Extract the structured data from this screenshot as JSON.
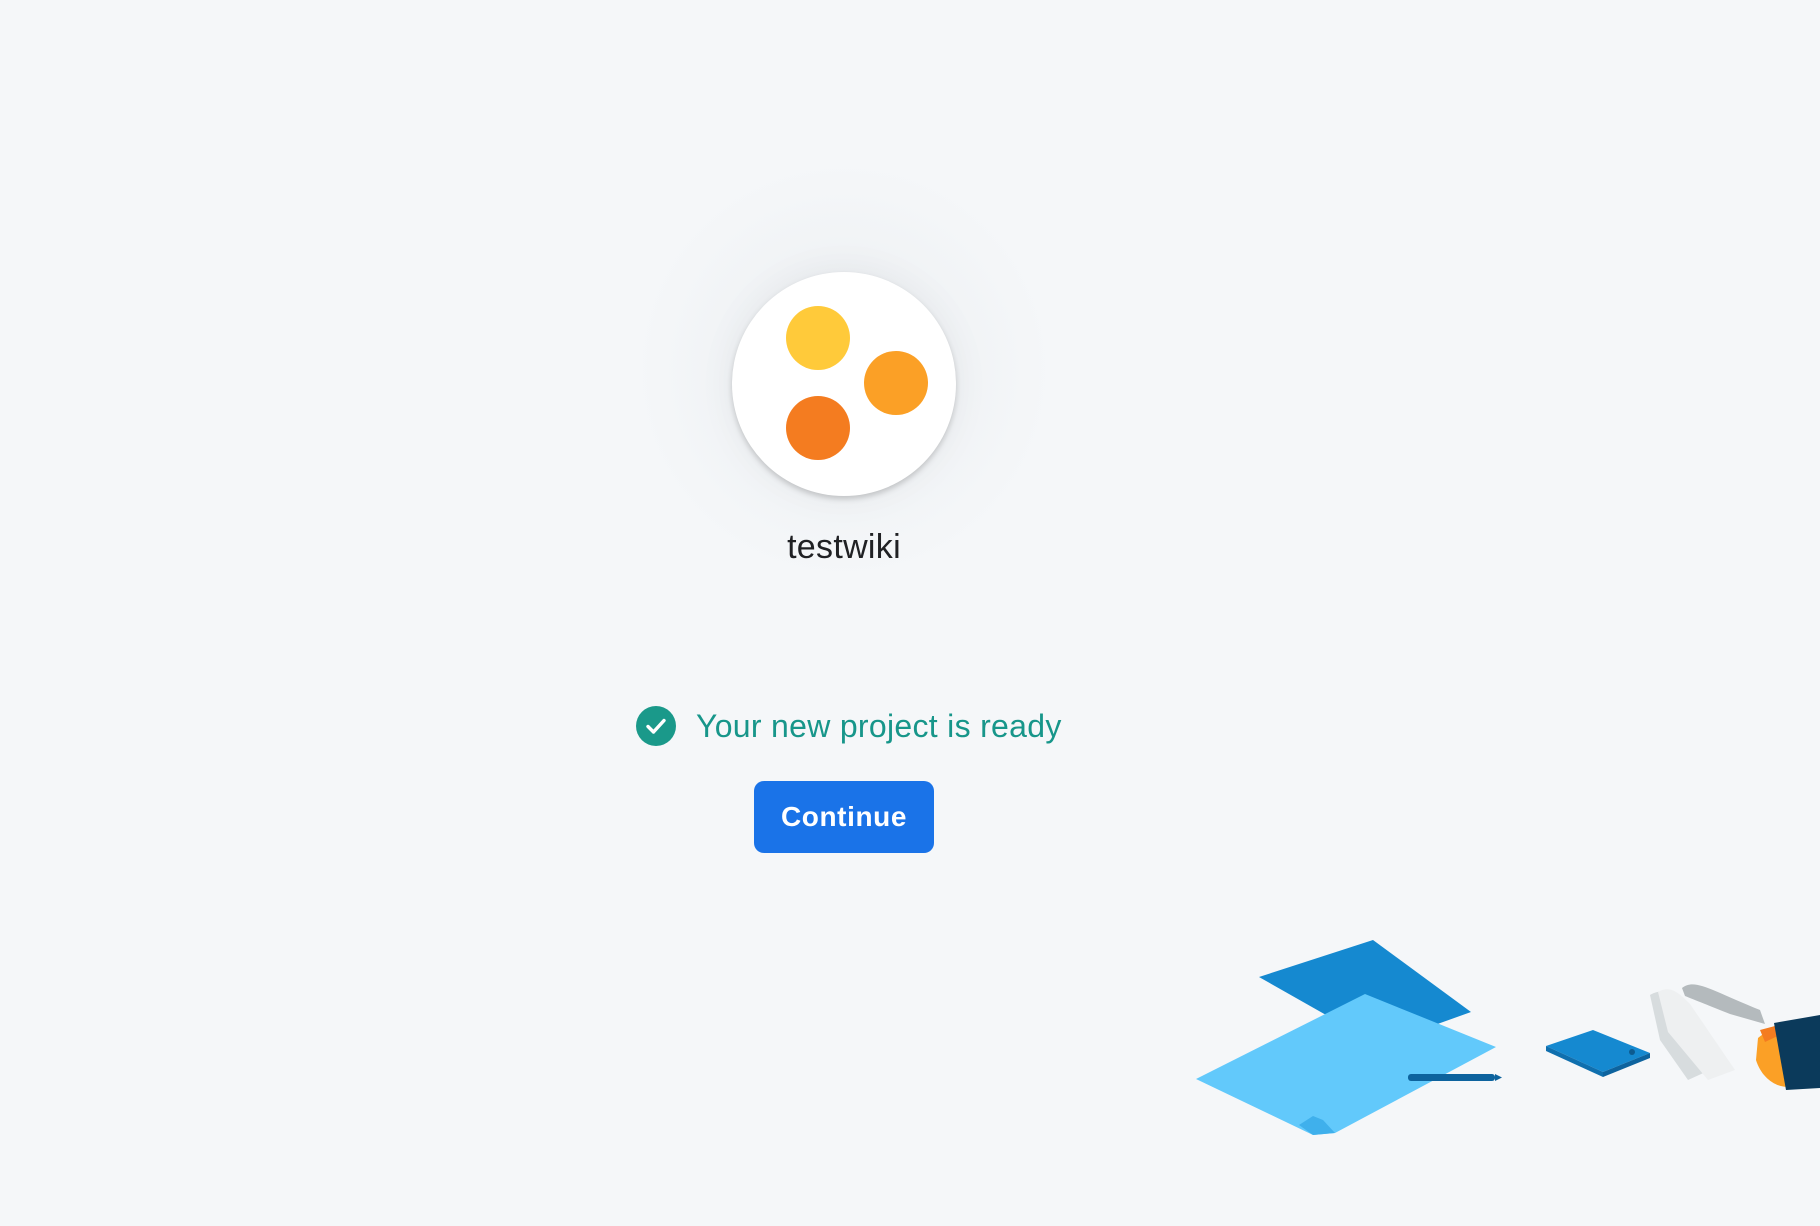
{
  "project": {
    "name": "testwiki",
    "avatar": {
      "icon": "three-dots-logo",
      "colors": [
        "#ffca3a",
        "#fba026",
        "#f47c20"
      ]
    }
  },
  "status": {
    "icon": "check-circle-icon",
    "text": "Your new project is ready",
    "color": "#17968a"
  },
  "actions": {
    "continue_label": "Continue",
    "accent": "#1a73e8"
  },
  "illustration": {
    "icon": "feet-on-papers-illustration"
  }
}
